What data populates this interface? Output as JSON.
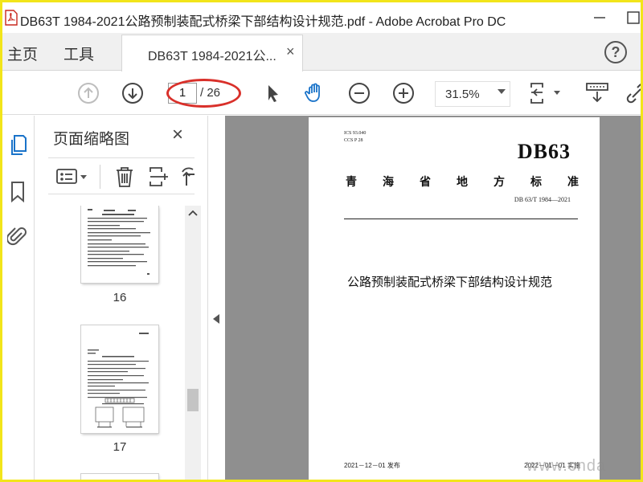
{
  "window": {
    "title": "DB63T 1984-2021公路预制装配式桥梁下部结构设计规范.pdf - Adobe Acrobat Pro DC"
  },
  "menubar": {
    "home": "主页",
    "tools": "工具",
    "doc_tab_label": "DB63T 1984-2021公...",
    "doc_tab_close": "×",
    "help": "?"
  },
  "toolbar": {
    "current_page": "1",
    "total_pages": "/ 26",
    "zoom": "31.5%"
  },
  "thumbnails": {
    "title": "页面缩略图",
    "close": "×",
    "pages": [
      {
        "number": "16"
      },
      {
        "number": "17"
      }
    ]
  },
  "document_page": {
    "ics": "ICS 93.040",
    "ccs": "CCS P 28",
    "db_code": "DB63",
    "province_chars": [
      "青",
      "海",
      "省",
      "地",
      "方",
      "标",
      "准"
    ],
    "standard_number": "DB 63/T 1984—2021",
    "doc_title": "公路预制装配式桥梁下部结构设计规范",
    "issue_date": "2021－12－01 发布",
    "impl_date": "2022－01－01 实施"
  },
  "watermark": {
    "bottom_right": "www.cnda"
  },
  "colors": {
    "border": "#f2e51a",
    "highlight": "#d9302a",
    "doc_background": "#8f8f8f",
    "hand_tool": "#1a73c9"
  }
}
